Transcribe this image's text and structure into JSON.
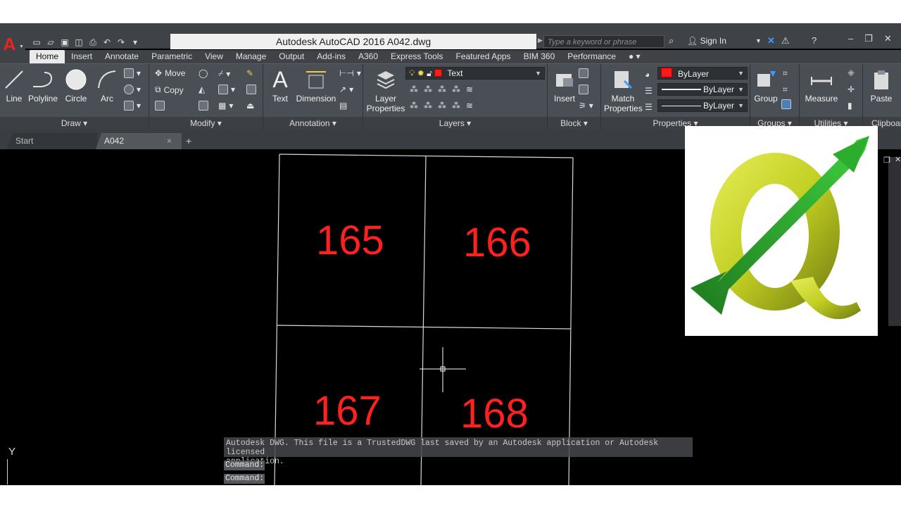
{
  "window": {
    "title": "Autodesk AutoCAD 2016    A042.dwg",
    "search_placeholder": "Type a keyword or phrase",
    "sign_in": "Sign In"
  },
  "tabs": [
    "Home",
    "Insert",
    "Annotate",
    "Parametric",
    "View",
    "Manage",
    "Output",
    "Add-ins",
    "A360",
    "Express Tools",
    "Featured Apps",
    "BIM 360",
    "Performance"
  ],
  "ribbon": {
    "draw": {
      "label": "Draw",
      "tools": [
        "Line",
        "Polyline",
        "Circle",
        "Arc"
      ]
    },
    "modify": {
      "label": "Modify",
      "move": "Move",
      "copy": "Copy"
    },
    "annotation": {
      "label": "Annotation",
      "text": "Text",
      "dimension": "Dimension"
    },
    "layers": {
      "label": "Layers",
      "layer_properties_1": "Layer",
      "layer_properties_2": "Properties",
      "layer_name": "Text"
    },
    "block": {
      "label": "Block",
      "insert": "Insert"
    },
    "properties": {
      "label": "Properties",
      "match_1": "Match",
      "match_2": "Properties",
      "color": "ByLayer",
      "linetype": "ByLayer",
      "lineweight": "ByLayer"
    },
    "groups": {
      "label": "Groups",
      "group": "Group"
    },
    "utilities": {
      "label": "Utilities",
      "measure": "Measure"
    },
    "clipboard": {
      "label": "Clipboar",
      "paste": "Paste"
    }
  },
  "doc_tabs": {
    "start": "Start",
    "current": "A042"
  },
  "drawing": {
    "cells": [
      "165",
      "166",
      "167",
      "168"
    ]
  },
  "command": {
    "history_1": "Autodesk DWG.  This file is a TrustedDWG last saved by an Autodesk application or Autodesk licensed",
    "history_2": "application.",
    "prompt_1": "Command:",
    "prompt_2": "Command:"
  },
  "ucs": {
    "y_label": "Y"
  },
  "colors": {
    "accent_red": "#ff2020",
    "ribbon_bg": "#4a4f55",
    "qgis_green": "#2a9a2a",
    "qgis_yellow": "#c8d62a"
  }
}
